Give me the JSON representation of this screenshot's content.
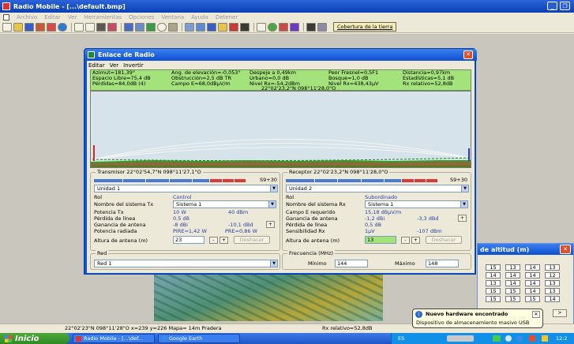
{
  "app": {
    "title": "Radio Mobile - [...\\default.bmp]"
  },
  "menu": [
    "Archivo",
    "Editar",
    "Ver",
    "Herramientas",
    "Opciones",
    "Ventana",
    "Ayuda",
    "Detener"
  ],
  "toolbar": {
    "coverage_label": "Cobertura de la tierra"
  },
  "dialog": {
    "title": "Enlace de Radio",
    "menu": [
      "Editar",
      "Ver",
      "Invertir"
    ],
    "info": {
      "azimut": "Azimut=181,39°",
      "espacio": "Espacio Libre=75,4 dB",
      "perdidas": "Pérdidas=84,0dB (4)",
      "angulo": "Ang. de elevación=-0,053°",
      "obstruccion": "Obstrucción=2,5 dB TR",
      "campo": "Campo E=68,0dBµV/m",
      "despeje": "Despeje a 0,49km",
      "urbano": "Urbano=0,0 dB",
      "nivel_rx": "Nivel Rx=-54,2dBm",
      "fresnel": "Peor Fresnel=0,5F1",
      "bosque": "Bosque=1,0 dB",
      "nivel_rx_uv": "Nivel Rx=438,43µV",
      "distancia": "Distancia=0,97km",
      "estadisticas": "Estadísticas=5,1 dB",
      "rx_relativo": "Rx relativo=52,8dB",
      "coords": "22°02'23,2\"N 098°11'28,0\"O"
    },
    "tx": {
      "legend": "Transmisor 22°02'54,7\"N 098°11'27,1\"O",
      "s_level": "S9+30",
      "unit": "Unidad  1",
      "rows": [
        {
          "label": "Rol",
          "value": "Control"
        },
        {
          "label": "Nombre del sistema Tx",
          "value": "Sistema  1"
        },
        {
          "label": "Potencia Tx",
          "value": "10 W",
          "value2": "40 dBm"
        },
        {
          "label": "Pérdida de línea",
          "value": "0,5 dB"
        },
        {
          "label": "Ganancia de antena",
          "value": "-8 dBi",
          "value2": "-10,1 dBd"
        },
        {
          "label": "Potencia radiada",
          "value": "PIRE=1,42 W",
          "value2": "PRE=0,86 W"
        }
      ],
      "antenna_label": "Altura de antena (m)",
      "antenna_value": "23",
      "undo": "Deshacer"
    },
    "rx": {
      "legend": "Receptor 22°02'23,2\"N 098°11'28,0\"O",
      "s_level": "S9+30",
      "unit": "Unidad  2",
      "rows": [
        {
          "label": "Rol",
          "value": "Subordinado"
        },
        {
          "label": "Nombre del sistema Rx",
          "value": "Sistema  1"
        },
        {
          "label": "Campo E requerido",
          "value": "15,18 dBµV/m"
        },
        {
          "label": "Ganancia de antena",
          "value": "-1,2 dBi",
          "value2": "-3,3 dBd"
        },
        {
          "label": "Pérdida de línea",
          "value": "0,5 dB"
        },
        {
          "label": "Sensibilidad Rx",
          "value": "1µV",
          "value2": "-107 dBm"
        }
      ],
      "antenna_label": "Altura de antena (m)",
      "antenna_value": "13",
      "undo": "Deshacer"
    },
    "red": {
      "legend": "Red",
      "value": "Red  1"
    },
    "freq": {
      "legend": "Frecuencia (MHz)",
      "min_label": "Mínimo",
      "min_value": "144",
      "max_label": "Máximo",
      "max_value": "148"
    }
  },
  "altitude": {
    "title": "de altitud (m)",
    "rows": [
      [
        "15",
        "13",
        "14",
        "13"
      ],
      [
        "14",
        "14",
        "14",
        "12"
      ],
      [
        "13",
        "14",
        "14",
        "13"
      ],
      [
        "15",
        "15",
        "14",
        "13"
      ],
      [
        "15",
        "15",
        "15",
        "14"
      ],
      [
        "",
        "",
        "",
        ""
      ]
    ]
  },
  "balloon": {
    "title": "Nuevo hardware encontrado",
    "text": "Dispositivo de almacenamiento masivo USB"
  },
  "status": {
    "coords": "22°02'23\"N 098°11'28\"O  x=239 y=226 Mapa= 14m Pradera",
    "rx": "Rx relativo=52,8dB"
  },
  "taskbar": {
    "start": "Inicio",
    "task1": "Radio Mobile - [...\\def...",
    "task2": "Google Earth",
    "lang": "ES",
    "clock": "12:2"
  }
}
